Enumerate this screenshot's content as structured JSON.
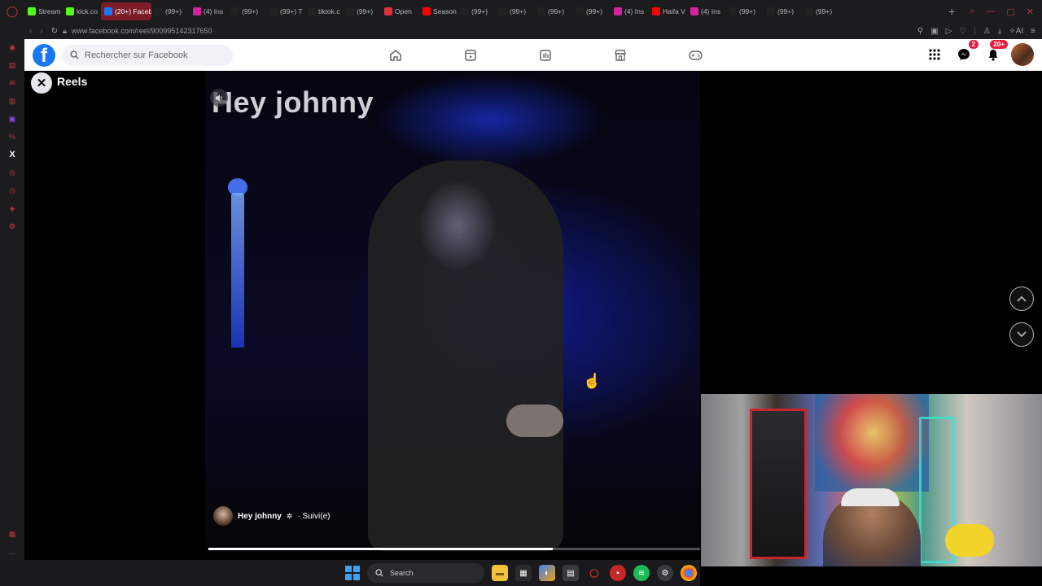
{
  "browser": {
    "tabs": [
      {
        "label": "Stream",
        "favicon": "kick-icon",
        "color": "#53fc18"
      },
      {
        "label": "kick.co",
        "favicon": "kick-icon",
        "color": "#53fc18"
      },
      {
        "label": "(20+) Faceb",
        "favicon": "facebook-icon",
        "color": "#1877f2",
        "active": true
      },
      {
        "label": "(99+)",
        "favicon": "tiktok-icon",
        "color": "#222222"
      },
      {
        "label": "(4) Ins",
        "favicon": "instagram-icon",
        "color": "#d6249f"
      },
      {
        "label": "(99+)",
        "favicon": "tiktok-icon",
        "color": "#222222"
      },
      {
        "label": "(99+) T",
        "favicon": "tiktok-icon",
        "color": "#222222"
      },
      {
        "label": "tiktok.c",
        "favicon": "tiktok-icon",
        "color": "#222222"
      },
      {
        "label": "(99+)",
        "favicon": "tiktok-icon",
        "color": "#222222"
      },
      {
        "label": "Open",
        "favicon": "gift-icon",
        "color": "#e0313b"
      },
      {
        "label": "Season",
        "favicon": "youtube-icon",
        "color": "#ff0000"
      },
      {
        "label": "(99+)",
        "favicon": "tiktok-icon",
        "color": "#222222"
      },
      {
        "label": "(99+)",
        "favicon": "tiktok-icon",
        "color": "#222222"
      },
      {
        "label": "(99+)",
        "favicon": "tiktok-icon",
        "color": "#222222"
      },
      {
        "label": "(99+)",
        "favicon": "tiktok-icon",
        "color": "#222222"
      },
      {
        "label": "(4) Ins",
        "favicon": "instagram-icon",
        "color": "#d6249f"
      },
      {
        "label": "Haifa V",
        "favicon": "youtube-icon",
        "color": "#ff0000"
      },
      {
        "label": "(4) Ins",
        "favicon": "instagram-icon",
        "color": "#d6249f"
      },
      {
        "label": "(99+)",
        "favicon": "tiktok-icon",
        "color": "#222222"
      },
      {
        "label": "(99+)",
        "favicon": "tiktok-icon",
        "color": "#222222"
      },
      {
        "label": "(99+)",
        "favicon": "tiktok-icon",
        "color": "#222222"
      }
    ],
    "url": "www.facebook.com/reel/900995142317650",
    "extension_label": "AI"
  },
  "facebook": {
    "search_placeholder": "Rechercher sur Facebook",
    "messenger_badge": "2",
    "notifications_badge": "20+"
  },
  "reels": {
    "title": "Reels",
    "video_caption": "Hey johnny",
    "author_name": "Hey johnny",
    "follow_status": "· Suivi(e)",
    "progress": 0.7
  },
  "taskbar": {
    "search_label": "Search"
  },
  "colors": {
    "facebook_blue": "#1877f2",
    "opera_red": "#e0313b",
    "badge_red": "#e41e3f"
  }
}
